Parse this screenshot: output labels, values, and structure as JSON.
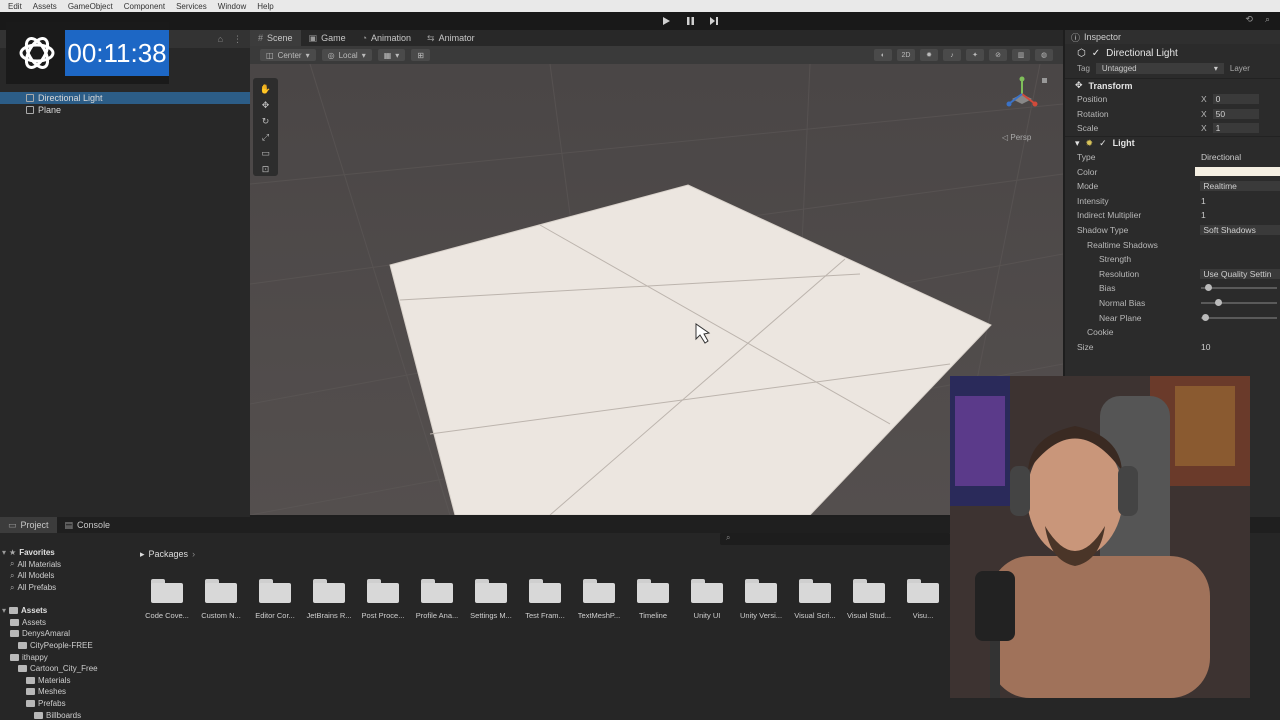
{
  "menu": [
    "Edit",
    "Assets",
    "GameObject",
    "Component",
    "Services",
    "Window",
    "Help"
  ],
  "timer": {
    "time": "00:11:38"
  },
  "hierarchy": {
    "items": [
      {
        "label": "Directional Light",
        "selected": true
      },
      {
        "label": "Plane",
        "selected": false
      }
    ]
  },
  "scene": {
    "tabs": [
      {
        "label": "Scene",
        "icon": "hash-icon",
        "active": true
      },
      {
        "label": "Game",
        "icon": "gamepad-icon",
        "active": false
      },
      {
        "label": "Animation",
        "icon": "animation-icon",
        "active": false
      },
      {
        "label": "Animator",
        "icon": "animator-icon",
        "active": false
      }
    ],
    "pivot": "Center",
    "space": "Local",
    "mode_2d": "2D",
    "persp": "Persp"
  },
  "inspector": {
    "tab": "Inspector",
    "object_name": "Directional Light",
    "tag_label": "Tag",
    "tag_value": "Untagged",
    "layer_label": "Layer",
    "transform": {
      "title": "Transform",
      "rows": [
        {
          "label": "Position",
          "axis": "X",
          "value": "0"
        },
        {
          "label": "Rotation",
          "axis": "X",
          "value": "50"
        },
        {
          "label": "Scale",
          "axis": "X",
          "value": "1"
        }
      ]
    },
    "light": {
      "title": "Light",
      "type_label": "Type",
      "type_value": "Directional",
      "color_label": "Color",
      "color_value": "#f4efe2",
      "mode_label": "Mode",
      "mode_value": "Realtime",
      "intensity_label": "Intensity",
      "intensity_value": "1",
      "indirect_label": "Indirect Multiplier",
      "indirect_value": "1",
      "shadow_label": "Shadow Type",
      "shadow_value": "Soft Shadows",
      "realtime_shadows": "Realtime Shadows",
      "strength_label": "Strength",
      "resolution_label": "Resolution",
      "resolution_value": "Use Quality Settin",
      "bias_label": "Bias",
      "bias_level": 0.05,
      "normal_bias_label": "Normal Bias",
      "normal_bias_level": 0.2,
      "near_plane_label": "Near Plane",
      "near_plane_level": 0.02,
      "cookie_label": "Cookie",
      "size_label": "Size",
      "size_value": "10"
    }
  },
  "bottom": {
    "tabs": [
      {
        "label": "Project",
        "icon": "folder-icon",
        "active": true
      },
      {
        "label": "Console",
        "icon": "console-icon",
        "active": false
      }
    ],
    "breadcrumb": "Packages",
    "tree": [
      {
        "label": "Favorites",
        "level": 0,
        "header": true,
        "icon": "star"
      },
      {
        "label": "All Materials",
        "level": 1,
        "icon": "search"
      },
      {
        "label": "All Models",
        "level": 1,
        "icon": "search"
      },
      {
        "label": "All Prefabs",
        "level": 1,
        "icon": "search"
      },
      {
        "label": "",
        "level": 0,
        "spacer": true
      },
      {
        "label": "Assets",
        "level": 0,
        "header": true,
        "icon": "folder"
      },
      {
        "label": "Assets",
        "level": 1,
        "icon": "folder"
      },
      {
        "label": "DenysAmaral",
        "level": 1,
        "icon": "folder"
      },
      {
        "label": "CityPeople-FREE",
        "level": 2,
        "icon": "folder"
      },
      {
        "label": "ithappy",
        "level": 1,
        "icon": "folder"
      },
      {
        "label": "Cartoon_City_Free",
        "level": 2,
        "icon": "folder"
      },
      {
        "label": "Materials",
        "level": 3,
        "icon": "folder"
      },
      {
        "label": "Meshes",
        "level": 3,
        "icon": "folder"
      },
      {
        "label": "Prefabs",
        "level": 3,
        "icon": "folder"
      },
      {
        "label": "Billboards",
        "level": 4,
        "icon": "folder"
      }
    ],
    "folders": [
      "Code Cove...",
      "Custom N...",
      "Editor Cor...",
      "JetBrains R...",
      "Post Proce...",
      "Profile Ana...",
      "Settings M...",
      "Test Fram...",
      "TextMeshP...",
      "Timeline",
      "Unity UI",
      "Unity Versi...",
      "Visual Scri...",
      "Visual Stud...",
      "Visu..."
    ]
  }
}
